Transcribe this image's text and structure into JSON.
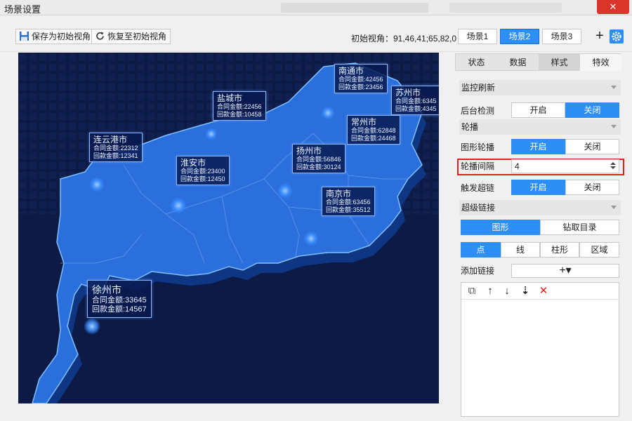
{
  "window": {
    "title": "场景设置",
    "close_glyph": "✕"
  },
  "toolbar": {
    "save_label": "保存为初始视角",
    "restore_label": "恢复至初始视角",
    "view_info": "初始视角：91,46,41;65,82,0",
    "scenes": [
      {
        "label": "场景1",
        "active": false
      },
      {
        "label": "场景2",
        "active": true
      },
      {
        "label": "场景3",
        "active": false
      }
    ],
    "plus_glyph": "+"
  },
  "map": {
    "background": "#0c1a45",
    "province_color": "#2a6fdc",
    "cities": [
      {
        "name": "南通市",
        "line1": "合同金额:42456",
        "line2": "回款金额:23456"
      },
      {
        "name": "盐城市",
        "line1": "合同金额:22456",
        "line2": "回款金额:10458"
      },
      {
        "name": "苏州市",
        "line1": "合同金额:6345",
        "line2": "回款金额:4345"
      },
      {
        "name": "连云港市",
        "line1": "合同金额:22312",
        "line2": "回款金额:12341"
      },
      {
        "name": "常州市",
        "line1": "合同金额:62848",
        "line2": "回款金额:24468"
      },
      {
        "name": "扬州市",
        "line1": "合同金额:56846",
        "line2": "回款金额:30124"
      },
      {
        "name": "淮安市",
        "line1": "合同金额:23400",
        "line2": "回款金额:12450"
      },
      {
        "name": "南京市",
        "line1": "合同金额:63456",
        "line2": "回款金额:35512"
      },
      {
        "name": "徐州市",
        "line1": "合同金额:33645",
        "line2": "回款金额:14567"
      }
    ]
  },
  "panel": {
    "tabs": [
      {
        "label": "状态"
      },
      {
        "label": "数据"
      },
      {
        "label": "样式"
      },
      {
        "label": "特效"
      }
    ],
    "sections": {
      "monitor": "监控刷新",
      "carousel": "轮播",
      "hyperlink": "超级链接"
    },
    "bg_detect": {
      "label": "后台检测",
      "on": "开启",
      "off": "关闭",
      "value": "off"
    },
    "shape_carousel": {
      "label": "图形轮播",
      "on": "开启",
      "off": "关闭",
      "value": "on"
    },
    "carousel_interval": {
      "label": "轮播间隔",
      "value": "4"
    },
    "trigger_link": {
      "label": "触发超链",
      "on": "开启",
      "off": "关闭",
      "value": "on"
    },
    "link_mode": {
      "options": [
        "图形",
        "钻取目录"
      ],
      "selected": "图形"
    },
    "shape_type": {
      "options": [
        "点",
        "线",
        "柱形",
        "区域"
      ],
      "selected": "点"
    },
    "add_link": {
      "label": "添加链接",
      "button_glyph": "+▾"
    },
    "toolbar_glyphs": {
      "copy": "⧉",
      "up": "↑",
      "down": "↓",
      "sort": "⇣",
      "delete": "✕"
    },
    "accent": "#2d8ef5",
    "highlight": "#e02020"
  }
}
